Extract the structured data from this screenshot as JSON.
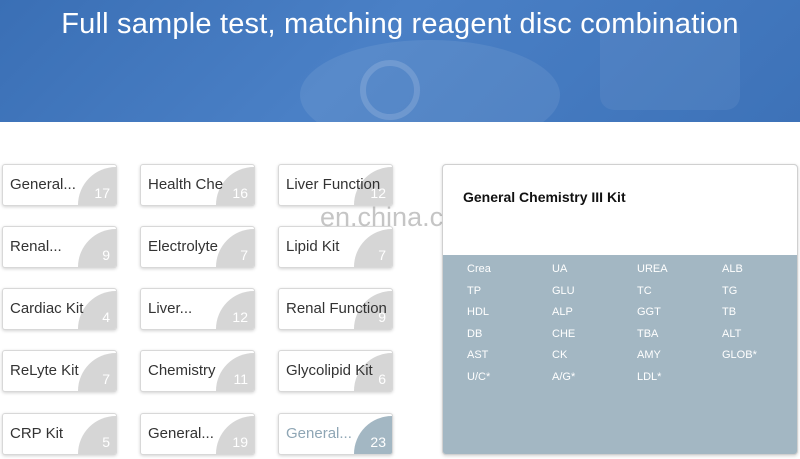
{
  "banner": {
    "title": "Full sample test, matching reagent disc combination"
  },
  "watermark": "en.china.cn",
  "kits": [
    {
      "label": "General...",
      "count": "17"
    },
    {
      "label": "Health Che",
      "count": "16"
    },
    {
      "label": "Liver Function",
      "count": "12"
    },
    {
      "label": "Renal...",
      "count": "9"
    },
    {
      "label": "Electrolyte",
      "count": "7"
    },
    {
      "label": "Lipid Kit",
      "count": "7"
    },
    {
      "label": "Cardiac Kit",
      "count": "4"
    },
    {
      "label": "Liver...",
      "count": "12"
    },
    {
      "label": "Renal Function",
      "count": "9"
    },
    {
      "label": "ReLyte Kit",
      "count": "7"
    },
    {
      "label": "Chemistry",
      "count": "11"
    },
    {
      "label": "Glycolipid Kit",
      "count": "6"
    },
    {
      "label": "CRP Kit",
      "count": "5"
    },
    {
      "label": "General...",
      "count": "19"
    },
    {
      "label": "General...",
      "count": "23",
      "active": true
    }
  ],
  "detail": {
    "title": "General Chemistry III Kit",
    "items": [
      "Crea",
      "UA",
      "UREA",
      "ALB",
      "TP",
      "GLU",
      "TC",
      "TG",
      "HDL",
      "ALP",
      "GGT",
      "TB",
      "DB",
      "CHE",
      "TBA",
      "ALT",
      "AST",
      "CK",
      "AMY",
      "GLOB*",
      "U/C*",
      "A/G*",
      "LDL*"
    ]
  },
  "colors": {
    "banner": "#3d72b8",
    "detail_panel": "#a3b7c3",
    "corner": "#d6d6d6"
  }
}
